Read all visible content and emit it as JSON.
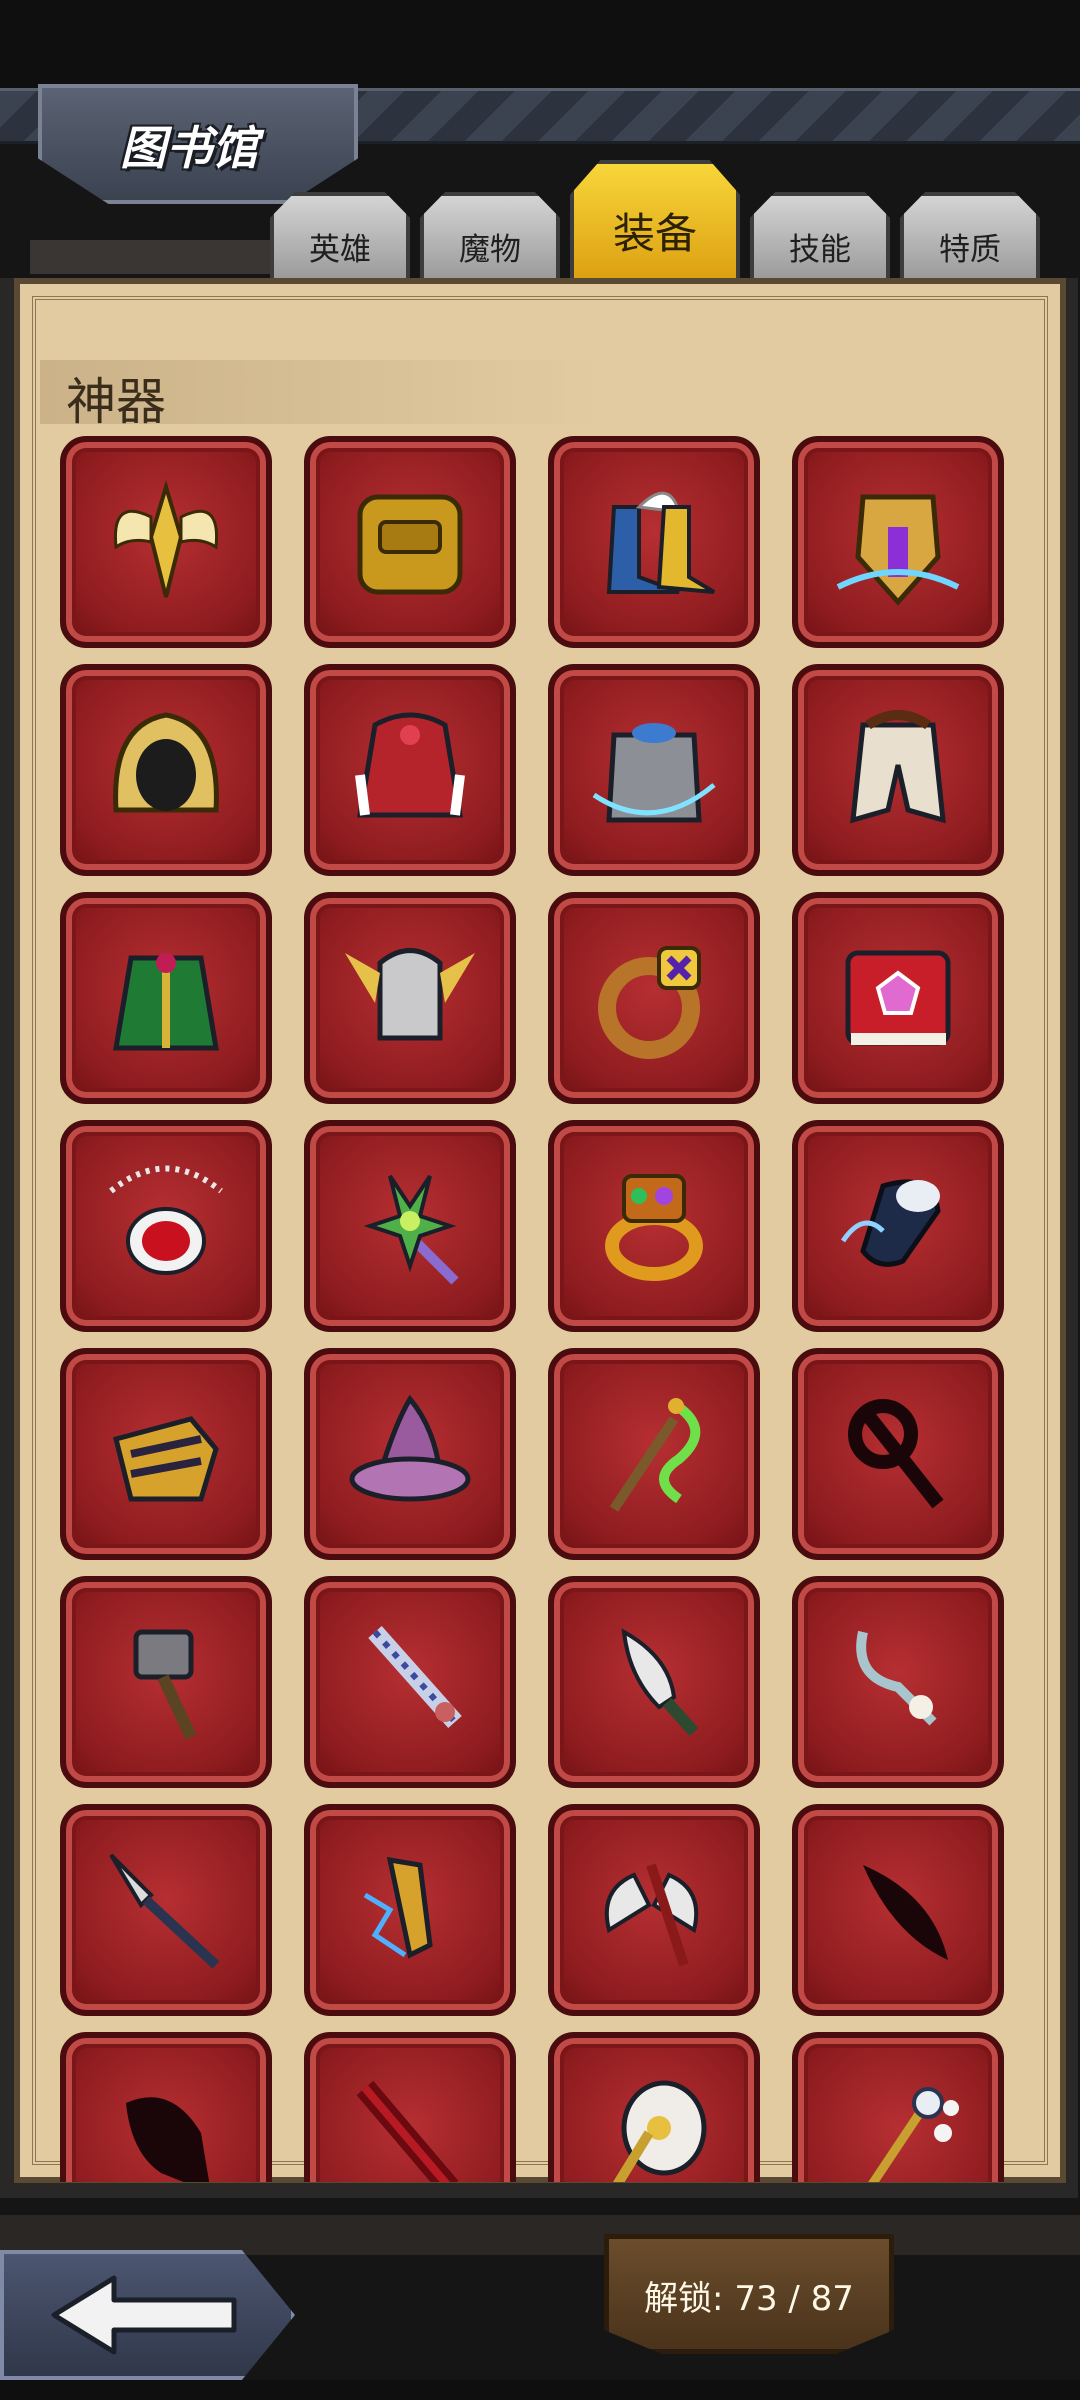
{
  "header": {
    "title": "图书馆"
  },
  "tabs": [
    {
      "label": "英雄",
      "active": false
    },
    {
      "label": "魔物",
      "active": false
    },
    {
      "label": "装备",
      "active": true
    },
    {
      "label": "技能",
      "active": false
    },
    {
      "label": "特质",
      "active": false
    }
  ],
  "section": {
    "title": "神器"
  },
  "items": [
    {
      "icon": "winged-axe-icon",
      "locked": false
    },
    {
      "icon": "backpack-icon",
      "locked": false
    },
    {
      "icon": "winged-boots-icon",
      "locked": false
    },
    {
      "icon": "crystal-shield-icon",
      "locked": false
    },
    {
      "icon": "golden-hood-icon",
      "locked": false
    },
    {
      "icon": "fur-cloak-icon",
      "locked": false
    },
    {
      "icon": "steel-armor-icon",
      "locked": false
    },
    {
      "icon": "collar-cloak-icon",
      "locked": false
    },
    {
      "icon": "green-robe-icon",
      "locked": false
    },
    {
      "icon": "winged-helm-icon",
      "locked": false
    },
    {
      "icon": "amethyst-ring-icon",
      "locked": false
    },
    {
      "icon": "spell-book-icon",
      "locked": false
    },
    {
      "icon": "ruby-amulet-icon",
      "locked": false
    },
    {
      "icon": "gem-scepter-icon",
      "locked": false
    },
    {
      "icon": "jeweled-ring-icon",
      "locked": false
    },
    {
      "icon": "ghost-gauntlet-icon",
      "locked": false
    },
    {
      "icon": "gold-gauntlet-icon",
      "locked": false
    },
    {
      "icon": "wizard-hat-icon",
      "locked": false
    },
    {
      "icon": "serpent-staff-icon",
      "locked": false
    },
    {
      "icon": "silhouette-staff-icon",
      "locked": true
    },
    {
      "icon": "war-hammer-icon",
      "locked": false
    },
    {
      "icon": "sapphire-sword-icon",
      "locked": false
    },
    {
      "icon": "poison-dagger-icon",
      "locked": false
    },
    {
      "icon": "bone-hook-icon",
      "locked": false
    },
    {
      "icon": "spear-icon",
      "locked": false
    },
    {
      "icon": "lightning-blade-icon",
      "locked": false
    },
    {
      "icon": "battle-axe-icon",
      "locked": false
    },
    {
      "icon": "silhouette-blade-icon",
      "locked": true
    },
    {
      "icon": "silhouette-weapon-icon",
      "locked": true
    },
    {
      "icon": "crimson-sword-icon",
      "locked": false
    },
    {
      "icon": "holy-axe-icon",
      "locked": false
    },
    {
      "icon": "bell-staff-icon",
      "locked": false
    }
  ],
  "footer": {
    "back_icon": "back-arrow-icon",
    "unlock_label": "解锁: 73 / 87"
  },
  "colors": {
    "slot_red": "#8e1c1f",
    "panel_parchment": "#e2cba0",
    "active_tab": "#f2c318"
  }
}
